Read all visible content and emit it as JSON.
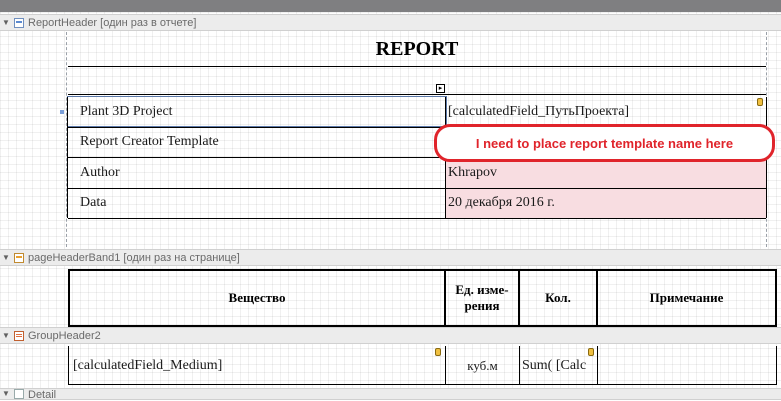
{
  "bands": {
    "report_header": "ReportHeader [один раз в отчете]",
    "page_header": "pageHeaderBand1 [один раз на странице]",
    "group_header": "GroupHeader2",
    "detail": "Detail"
  },
  "report": {
    "title": "REPORT",
    "nav_glyph": "▸",
    "rows": [
      {
        "label": "Plant 3D Project",
        "value": "[calculatedField_ПутьПроекта]"
      },
      {
        "label": "Report Creator Template",
        "value": ""
      },
      {
        "label": "Author",
        "value": "Khrapov"
      },
      {
        "label": "Data",
        "value": "20 декабря 2016 г."
      }
    ]
  },
  "annotation": "I need to place report template name here",
  "page_header": {
    "columns": [
      "Вещество",
      "Ед. изме-\nрения",
      "Кол.",
      "Примечание"
    ]
  },
  "group_header": {
    "cells": [
      "[calculatedField_Medium]",
      "куб.м",
      "Sum( [Calc",
      ""
    ]
  },
  "colors": {
    "annotation_red": "#e0242b",
    "highlight_pink": "#f8dde1",
    "band_gray": "#ececec"
  }
}
